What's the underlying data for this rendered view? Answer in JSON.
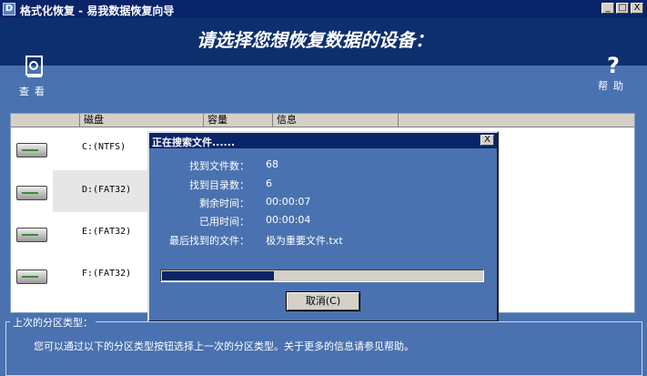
{
  "window": {
    "title": "格式化恢复 - 易我数据恢复向导",
    "app_icon": "D",
    "minimize": "_",
    "maximize": "□",
    "close": "X"
  },
  "header": {
    "headline": "请选择您想恢复数据的设备："
  },
  "toolbar": {
    "view": {
      "label": "查看",
      "icon": "disk-magnifier-icon"
    },
    "help": {
      "label": "帮助",
      "icon": "question-icon"
    }
  },
  "table": {
    "columns": [
      "磁盘",
      "容量",
      "信息"
    ],
    "rows": [
      {
        "name": "C:(NTFS)"
      },
      {
        "name": "D:(FAT32)",
        "selected": true
      },
      {
        "name": "E:(FAT32)"
      },
      {
        "name": "F:(FAT32)"
      }
    ]
  },
  "dialog": {
    "title": "正在搜索文件......",
    "close": "X",
    "files_found_label": "找到文件数：",
    "files_found": "68",
    "dirs_found_label": "找到目录数：",
    "dirs_found": "6",
    "remaining_label": "剩余时间：",
    "remaining": "00:00:07",
    "elapsed_label": "已用时间：",
    "elapsed": "00:00:04",
    "last_file_label": "最后找到的文件：",
    "last_file": "极为重要文件.txt",
    "progress_fraction": 0.35,
    "cancel_label": "取消(C)"
  },
  "partition": {
    "legend": "上次的分区类型：",
    "description": "您可以通过以下的分区类型按钮选择上一次的分区类型。关于更多的信息请参见帮助。"
  },
  "colors": {
    "background": "#4a72b0",
    "title_bar": "#0a246a",
    "header": "#0e2f6e"
  }
}
